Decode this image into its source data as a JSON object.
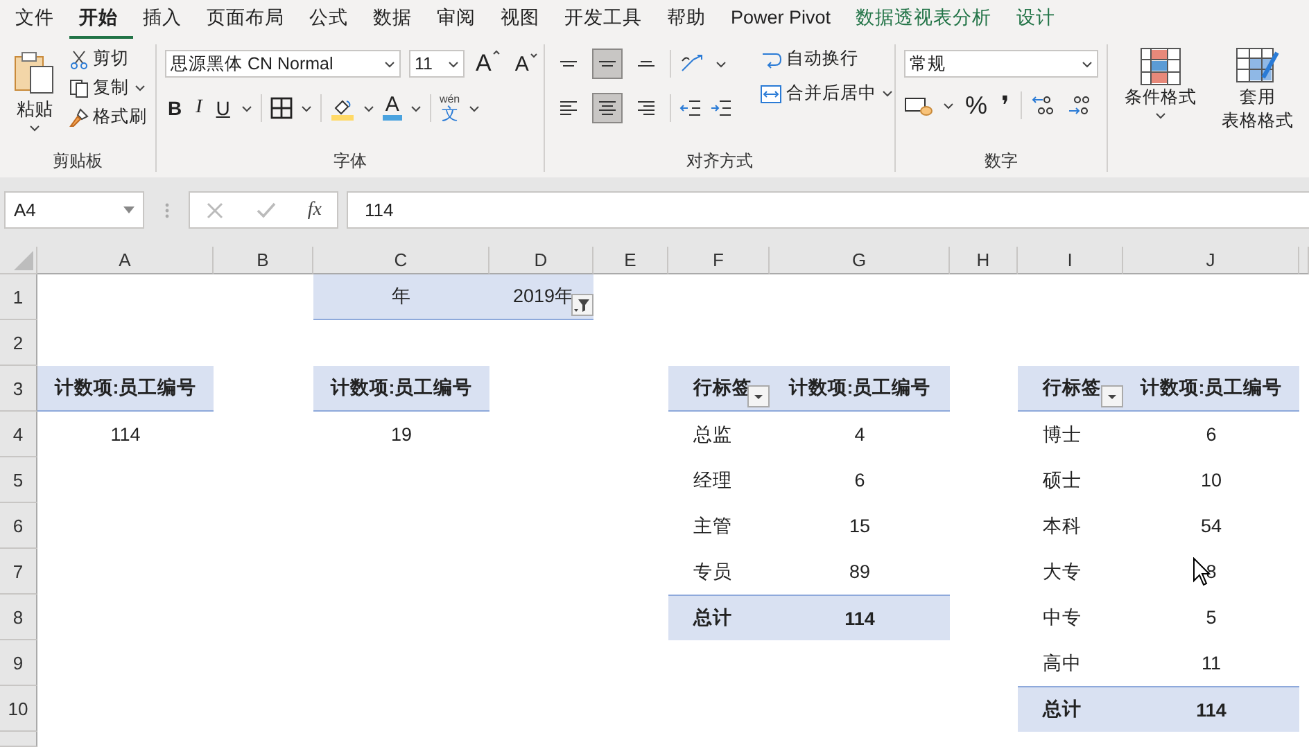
{
  "ribbon_tabs": [
    {
      "label": "文件",
      "selected": false,
      "kind": "normal"
    },
    {
      "label": "开始",
      "selected": true,
      "kind": "normal"
    },
    {
      "label": "插入",
      "selected": false,
      "kind": "normal"
    },
    {
      "label": "页面布局",
      "selected": false,
      "kind": "normal"
    },
    {
      "label": "公式",
      "selected": false,
      "kind": "normal"
    },
    {
      "label": "数据",
      "selected": false,
      "kind": "normal"
    },
    {
      "label": "审阅",
      "selected": false,
      "kind": "normal"
    },
    {
      "label": "视图",
      "selected": false,
      "kind": "normal"
    },
    {
      "label": "开发工具",
      "selected": false,
      "kind": "normal"
    },
    {
      "label": "帮助",
      "selected": false,
      "kind": "normal"
    },
    {
      "label": "Power Pivot",
      "selected": false,
      "kind": "normal"
    },
    {
      "label": "数据透视表分析",
      "selected": false,
      "kind": "contextual"
    },
    {
      "label": "设计",
      "selected": false,
      "kind": "contextual"
    }
  ],
  "clipboard": {
    "title": "剪贴板",
    "paste": "粘贴",
    "cut": "剪切",
    "copy": "复制",
    "format_painter": "格式刷"
  },
  "font": {
    "title": "字体",
    "name": "思源黑体 CN Normal",
    "size": "11",
    "grow": "A",
    "shrink": "A",
    "bold": "B",
    "italic": "I",
    "underline": "U",
    "font_color_glyph": "A",
    "phonetic_top": "wén",
    "phonetic": "文"
  },
  "alignment": {
    "title": "对齐方式",
    "top_row": [
      {
        "kind": "top",
        "selected": false
      },
      {
        "kind": "middle",
        "selected": true
      },
      {
        "kind": "bottom",
        "selected": false
      }
    ],
    "bottom_row": [
      {
        "kind": "left",
        "selected": false
      },
      {
        "kind": "center",
        "selected": true
      },
      {
        "kind": "right",
        "selected": false
      }
    ],
    "wrap": "自动换行",
    "merge": "合并后居中"
  },
  "number": {
    "title": "数字",
    "format": "常规",
    "percent": "%",
    "comma": "❜"
  },
  "styles": {
    "conditional": "条件格式",
    "table_format_1": "套用",
    "table_format_2": "表格格式"
  },
  "formula_bar": {
    "name_box": "A4",
    "fx": "fx",
    "value": "114"
  },
  "sheet": {
    "columns": [
      "A",
      "B",
      "C",
      "D",
      "E",
      "F",
      "G",
      "H",
      "I",
      "J"
    ],
    "rows": [
      "1",
      "2",
      "3",
      "4",
      "5",
      "6",
      "7",
      "8",
      "9",
      "10"
    ],
    "page_filter": {
      "label": "年",
      "value": "2019年"
    },
    "pivots": [
      {
        "value_header": "计数项:员工编号",
        "rows": [
          {
            "value": "114"
          }
        ]
      },
      {
        "value_header": "计数项:员工编号",
        "rows": [
          {
            "value": "19"
          }
        ]
      },
      {
        "row_header": "行标签",
        "value_header": "计数项:员工编号",
        "rows": [
          {
            "label": "总监",
            "value": "4"
          },
          {
            "label": "经理",
            "value": "6"
          },
          {
            "label": "主管",
            "value": "15"
          },
          {
            "label": "专员",
            "value": "89"
          }
        ],
        "total": {
          "label": "总计",
          "value": "114"
        }
      },
      {
        "row_header": "行标签",
        "value_header": "计数项:员工编号",
        "rows": [
          {
            "label": "博士",
            "value": "6"
          },
          {
            "label": "硕士",
            "value": "10"
          },
          {
            "label": "本科",
            "value": "54"
          },
          {
            "label": "大专",
            "value": "8",
            "pointer_over": true
          },
          {
            "label": "中专",
            "value": "5"
          },
          {
            "label": "高中",
            "value": "11"
          }
        ],
        "total": {
          "label": "总计",
          "value": "114"
        }
      }
    ]
  }
}
